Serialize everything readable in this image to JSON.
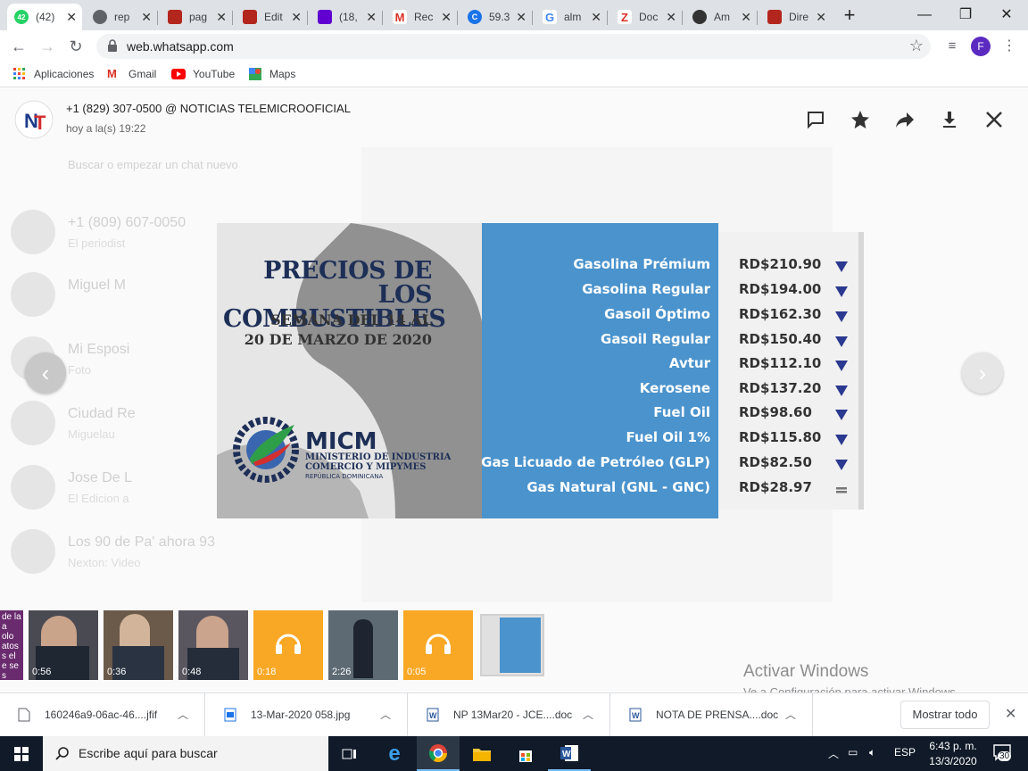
{
  "browser": {
    "tabs": [
      {
        "title": "(42)",
        "badge": "42",
        "color": "#25d366",
        "active": true
      },
      {
        "title": "rep",
        "color": "#5f6368"
      },
      {
        "title": "pag",
        "color": "#b3261e"
      },
      {
        "title": "Edit",
        "color": "#b3261e"
      },
      {
        "title": "(18,",
        "color": "#6001d2"
      },
      {
        "title": "Rec",
        "color": "#d93025"
      },
      {
        "title": "59.3",
        "color": "#1a73e8"
      },
      {
        "title": "alm",
        "color": "#4285f4"
      },
      {
        "title": "Doc",
        "color": "#d93025"
      },
      {
        "title": "Am",
        "color": "#333333"
      },
      {
        "title": "Dire",
        "color": "#b3261e"
      }
    ],
    "new_tab_label": "+",
    "window_controls": {
      "minimize": "—",
      "restore": "❐",
      "close": "✕"
    },
    "url": "web.whatsapp.com",
    "profile_initial": "F",
    "bookmarks": [
      {
        "label": "Aplicaciones",
        "icon": "apps-grid-icon"
      },
      {
        "label": "Gmail",
        "icon": "gmail-icon"
      },
      {
        "label": "YouTube",
        "icon": "youtube-icon"
      },
      {
        "label": "Maps",
        "icon": "maps-icon"
      }
    ]
  },
  "viewer": {
    "sender": "+1 (829) 307-0500 @ NOTICIAS TELEMICROOFICIAL",
    "time": "hoy a la(s) 19:22",
    "actions": [
      "reply-icon",
      "star-icon",
      "forward-icon",
      "download-icon",
      "close-icon"
    ]
  },
  "poster": {
    "title_line1": "PRECIOS DE LOS",
    "title_line2": "COMBUSTIBLES",
    "week_line1": "SEMANA DEL 14 AL",
    "week_line2": "20 DE MARZO DE 2020",
    "logo_name": "MICM",
    "logo_sub1": "MINISTERIO DE INDUSTRIA",
    "logo_sub2": "COMERCIO Y MIPYMES",
    "logo_sub3": "REPÚBLICA DOMINICANA",
    "fuels": [
      {
        "name": "Gasolina Prémium",
        "price": "RD$210.90",
        "trend": "down"
      },
      {
        "name": "Gasolina Regular",
        "price": "RD$194.00",
        "trend": "down"
      },
      {
        "name": "Gasoil Óptimo",
        "price": "RD$162.30",
        "trend": "down"
      },
      {
        "name": "Gasoil Regular",
        "price": "RD$150.40",
        "trend": "down"
      },
      {
        "name": "Avtur",
        "price": "RD$112.10",
        "trend": "down"
      },
      {
        "name": "Kerosene",
        "price": "RD$137.20",
        "trend": "down"
      },
      {
        "name": "Fuel Oil",
        "price": "RD$98.60",
        "trend": "down"
      },
      {
        "name": "Fuel Oil 1%",
        "price": "RD$115.80",
        "trend": "down"
      },
      {
        "name": "Gas Licuado de Petróleo (GLP)",
        "price": "RD$82.50",
        "trend": "down"
      },
      {
        "name": "Gas Natural (GNL - GNC)",
        "price": "RD$28.97",
        "trend": "same"
      }
    ],
    "colors": {
      "blue_panel": "#4a93cd",
      "navy": "#1d2f57",
      "arrow": "#2b3990"
    }
  },
  "background_chat": {
    "list": [
      {
        "name": "+1 (809) 607-0050",
        "sub": "El periodist"
      },
      {
        "name": "Miguel M",
        "sub": ""
      },
      {
        "name": "Mi Esposi",
        "sub": "Foto"
      },
      {
        "name": "Ciudad Re",
        "sub": "Miguelau"
      },
      {
        "name": "Jose De L",
        "sub": "El Edicion a"
      },
      {
        "name": "Los 90 de Pa' ahora 93",
        "sub": "Nexton: Video"
      }
    ],
    "search_placeholder": "Buscar o empezar un chat nuevo"
  },
  "thumbnails": [
    {
      "type": "video",
      "duration": "0:56"
    },
    {
      "type": "video",
      "duration": "0:36"
    },
    {
      "type": "video",
      "duration": "0:48"
    },
    {
      "type": "audio",
      "duration": "0:18"
    },
    {
      "type": "video",
      "duration": "2:26"
    },
    {
      "type": "audio",
      "duration": "0:05"
    },
    {
      "type": "image",
      "duration": ""
    }
  ],
  "windows_watermark": {
    "line1": "Activar Windows",
    "line2": "Ve a Configuración para activar Windows."
  },
  "downloads": {
    "items": [
      {
        "name": "160246a9-06ac-46....jfif",
        "icon": "file-icon"
      },
      {
        "name": "13-Mar-2020 058.jpg",
        "icon": "image-file-icon"
      },
      {
        "name": "NP 13Mar20 - JCE....doc",
        "icon": "word-file-icon"
      },
      {
        "name": "NOTA DE PRENSA....doc",
        "icon": "word-file-icon"
      }
    ],
    "show_all": "Mostrar todo"
  },
  "taskbar": {
    "search_placeholder": "Escribe aquí para buscar",
    "lang": "ESP",
    "time": "6:43 p. m.",
    "date": "13/3/2020",
    "notifications": "30"
  }
}
